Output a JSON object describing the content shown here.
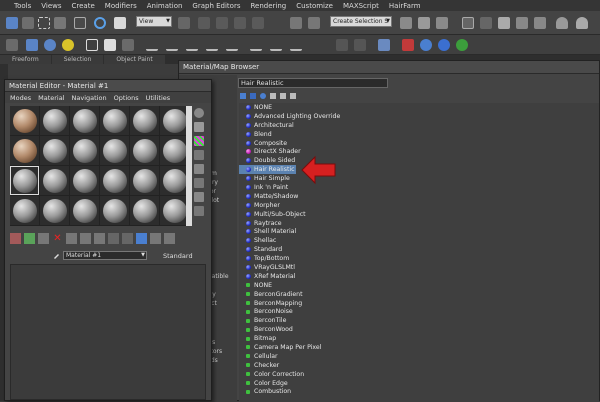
{
  "menubar": {
    "items": [
      "Tools",
      "Views",
      "Create",
      "Modifiers",
      "Animation",
      "Graph Editors",
      "Rendering",
      "Customize",
      "MAXScript",
      "HairFarm"
    ]
  },
  "toolbar": {
    "view_dropdown": "View",
    "selection_set_dropdown": "Create Selection S"
  },
  "ribbon": {
    "tabs": [
      "Freeform",
      "Selection",
      "Object Paint"
    ]
  },
  "browser": {
    "title": "Material/Map Browser",
    "search_value": "Hair Realistic",
    "left_partial_labels": [
      "From",
      "brary",
      "ditor",
      "e Slot",
      "ted",
      "ed",
      "ials",
      "mpatible",
      "Only",
      "bject",
      "ps",
      "itors",
      "ositors",
      "Mods"
    ],
    "materials": [
      {
        "label": "NONE",
        "icon": "blue"
      },
      {
        "label": "Advanced Lighting Override",
        "icon": "blue"
      },
      {
        "label": "Architectural",
        "icon": "blue"
      },
      {
        "label": "Blend",
        "icon": "blue"
      },
      {
        "label": "Composite",
        "icon": "blue"
      },
      {
        "label": "DirectX Shader",
        "icon": "magenta"
      },
      {
        "label": "Double Sided",
        "icon": "blue"
      },
      {
        "label": "Hair Realistic",
        "icon": "blue",
        "selected": true
      },
      {
        "label": "Hair Simple",
        "icon": "blue"
      },
      {
        "label": "Ink 'n Paint",
        "icon": "blue"
      },
      {
        "label": "Matte/Shadow",
        "icon": "blue"
      },
      {
        "label": "Morpher",
        "icon": "blue"
      },
      {
        "label": "Multi/Sub-Object",
        "icon": "blue"
      },
      {
        "label": "Raytrace",
        "icon": "blue"
      },
      {
        "label": "Shell Material",
        "icon": "blue"
      },
      {
        "label": "Shellac",
        "icon": "blue"
      },
      {
        "label": "Standard",
        "icon": "blue"
      },
      {
        "label": "Top/Bottom",
        "icon": "blue"
      },
      {
        "label": "VRayGLSLMtl",
        "icon": "blue"
      },
      {
        "label": "XRef Material",
        "icon": "blue"
      }
    ],
    "maps": [
      {
        "label": "NONE",
        "icon": "green"
      },
      {
        "label": "BerconGradient",
        "icon": "green"
      },
      {
        "label": "BerconMapping",
        "icon": "green"
      },
      {
        "label": "BerconNoise",
        "icon": "green"
      },
      {
        "label": "BerconTile",
        "icon": "green"
      },
      {
        "label": "BerconWood",
        "icon": "green"
      },
      {
        "label": "Bitmap",
        "icon": "green"
      },
      {
        "label": "Camera Map Per Pixel",
        "icon": "green"
      },
      {
        "label": "Cellular",
        "icon": "green"
      },
      {
        "label": "Checker",
        "icon": "green"
      },
      {
        "label": "Color Correction",
        "icon": "green"
      },
      {
        "label": "Color Edge",
        "icon": "green"
      },
      {
        "label": "Combustion",
        "icon": "green"
      }
    ]
  },
  "material_editor": {
    "title": "Material Editor - Material #1",
    "menu": [
      "Modes",
      "Material",
      "Navigation",
      "Options",
      "Utilities"
    ],
    "material_name": "Material #1",
    "material_type": "Standard"
  },
  "colors": {
    "selection": "#5b82b0",
    "arrow": "#d62020",
    "background": "#3c3c3c"
  }
}
